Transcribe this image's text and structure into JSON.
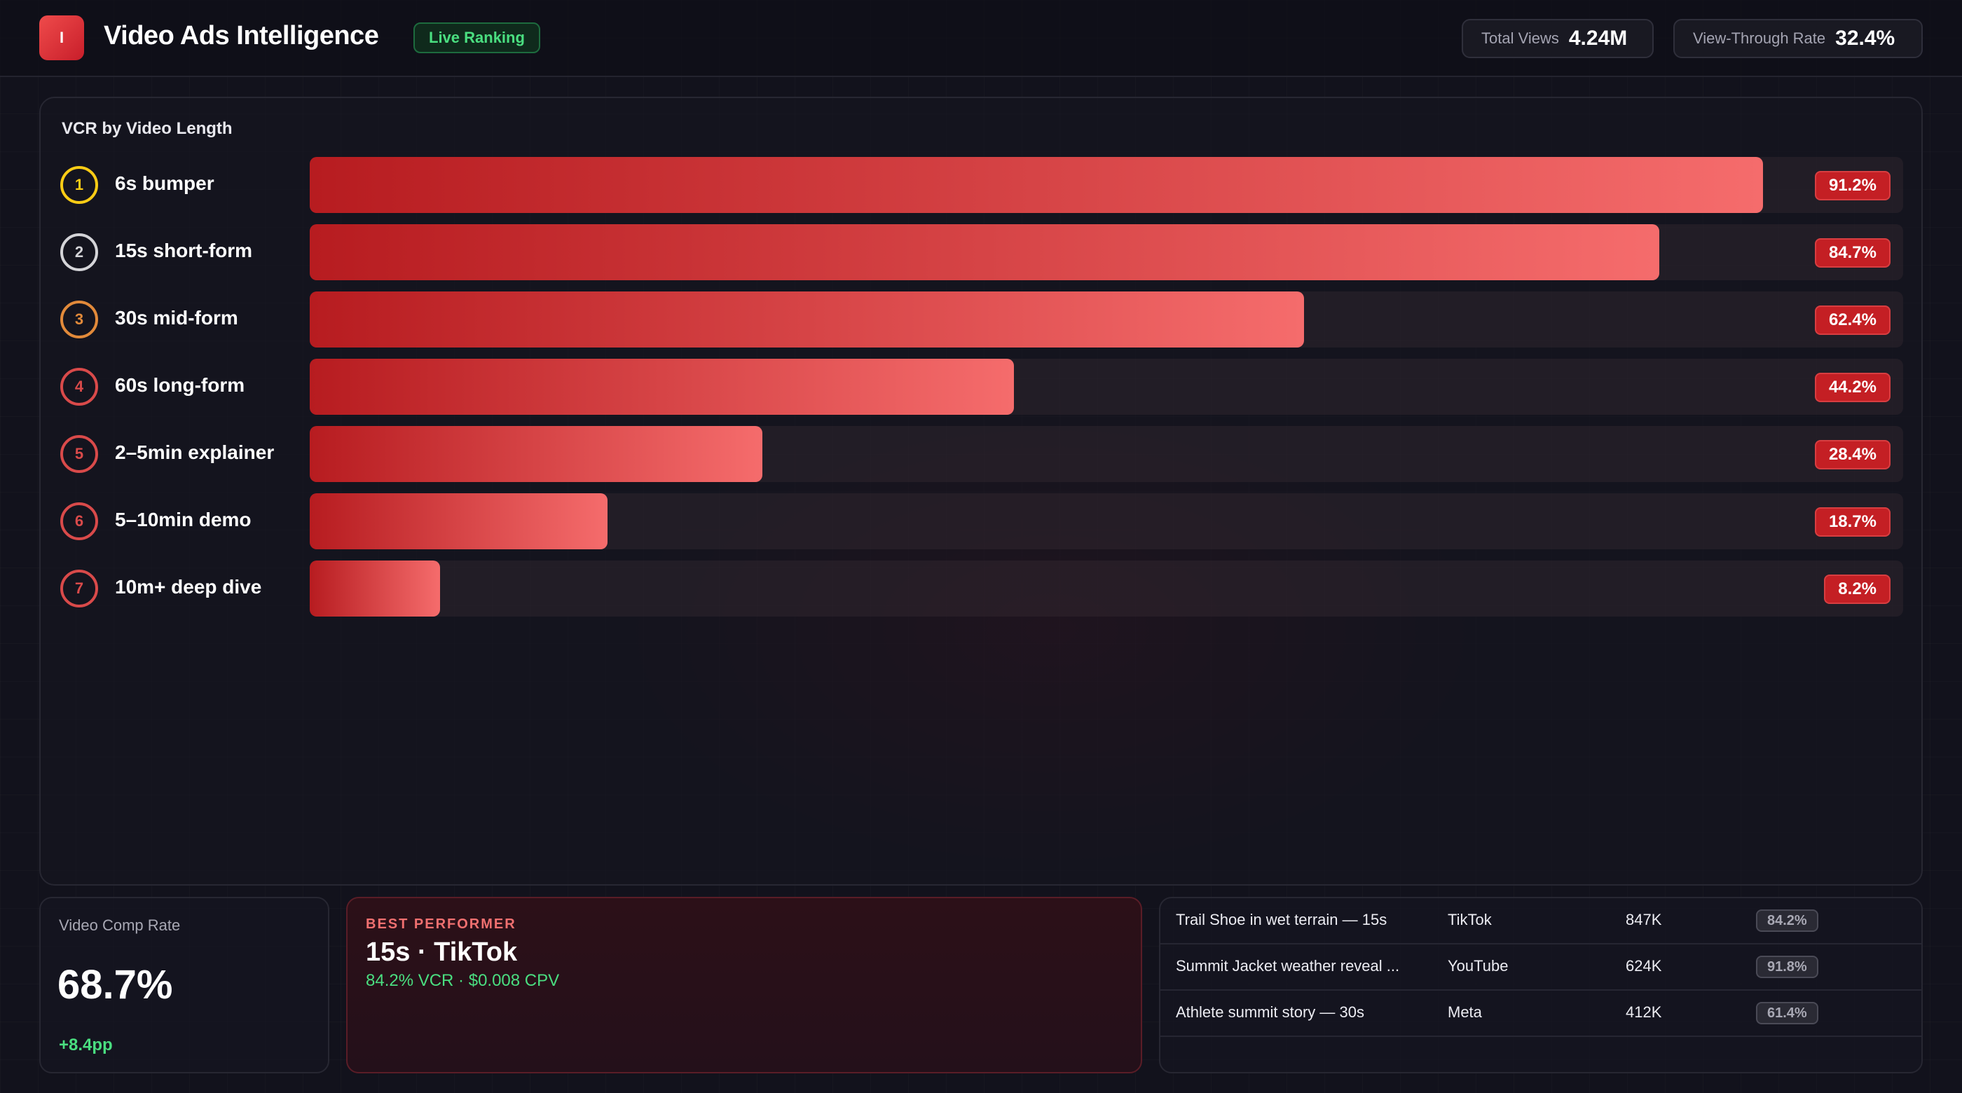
{
  "header": {
    "logo_letter": "I",
    "title": "Video Ads Intelligence",
    "live_badge": "Live Ranking",
    "stats": [
      {
        "label": "Total Views",
        "value": "4.24M"
      },
      {
        "label": "View-Through Rate",
        "value": "32.4%"
      }
    ]
  },
  "chart": {
    "title": "VCR by Video Length"
  },
  "chart_data": {
    "type": "bar",
    "orientation": "horizontal",
    "title": "VCR by Video Length",
    "categories": [
      "6s bumper",
      "15s short-form",
      "30s mid-form",
      "60s long-form",
      "2–5min explainer",
      "5–10min demo",
      "10m+ deep dive"
    ],
    "ranks": [
      "1",
      "2",
      "3",
      "4",
      "5",
      "6",
      "7"
    ],
    "values": [
      91.2,
      84.7,
      62.4,
      44.2,
      28.4,
      18.7,
      8.2
    ],
    "value_labels": [
      "91.2%",
      "84.7%",
      "62.4%",
      "44.2%",
      "28.4%",
      "18.7%",
      "8.2%"
    ],
    "xlim": [
      0,
      100
    ],
    "bar_colors": [
      "#b71c20",
      "#f56c6c"
    ],
    "rank_colors": [
      "#facc15",
      "#d4d4d8",
      "#e28a3a",
      "#d94a4a",
      "#d94a4a",
      "#d94a4a",
      "#d94a4a"
    ]
  },
  "cards": {
    "comp": {
      "label": "Video Comp Rate",
      "value": "68.7%",
      "delta": "+8.4pp"
    },
    "best": {
      "label": "BEST PERFORMER",
      "title": "15s · TikTok",
      "sub": "84.2% VCR · $0.008 CPV"
    },
    "list": [
      {
        "name": "Trail Shoe in wet terrain — 15s",
        "platform": "TikTok",
        "views": "847K",
        "rate": "84.2%"
      },
      {
        "name": "Summit Jacket weather reveal ...",
        "platform": "YouTube",
        "views": "624K",
        "rate": "91.8%"
      },
      {
        "name": "Athlete summit story — 30s",
        "platform": "Meta",
        "views": "412K",
        "rate": "61.4%"
      }
    ]
  }
}
